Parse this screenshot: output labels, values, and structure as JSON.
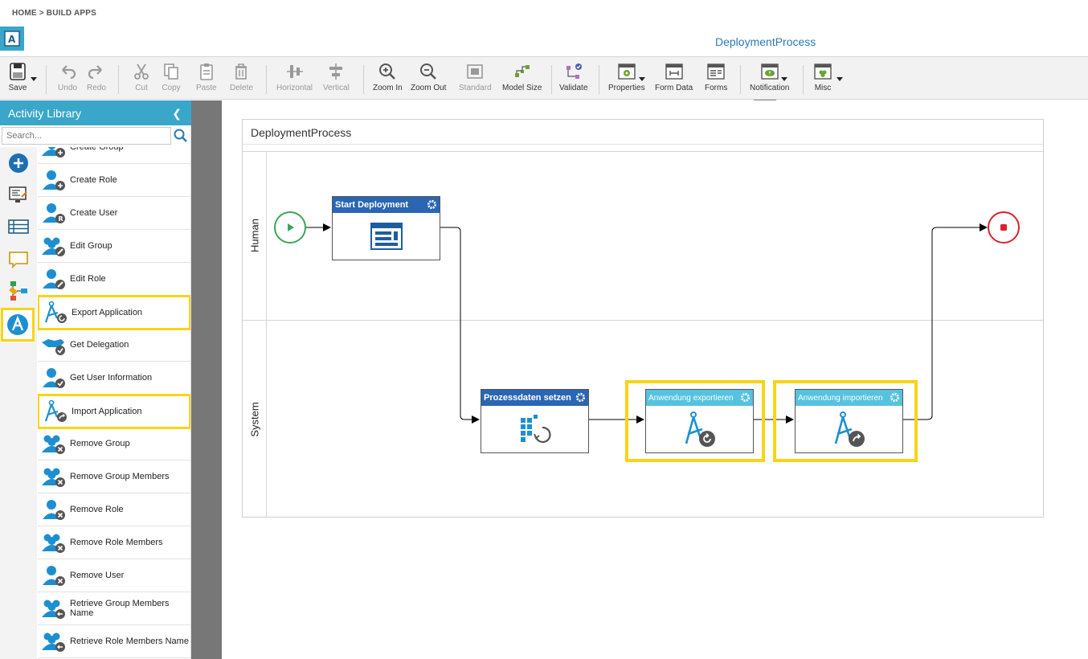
{
  "breadcrumb": "HOME > BUILD APPS",
  "app_title": "DeploymentProcess",
  "toolbar": {
    "save": "Save",
    "undo": "Undo",
    "redo": "Redo",
    "cut": "Cut",
    "copy": "Copy",
    "paste": "Paste",
    "delete": "Delete",
    "horizontal": "Horizontal",
    "vertical": "Vertical",
    "zoom_in": "Zoom In",
    "zoom_out": "Zoom Out",
    "standard": "Standard",
    "model_size": "Model Size",
    "validate": "Validate",
    "properties": "Properties",
    "form_data": "Form Data",
    "forms": "Forms",
    "notification": "Notification",
    "misc": "Misc"
  },
  "sidebar": {
    "title": "Activity Library",
    "search_placeholder": "Search...",
    "categories": [
      "add-icon",
      "form-icon",
      "list-icon",
      "comment-icon",
      "workflow-icon",
      "apps-icon"
    ],
    "items": [
      {
        "label": "Create Group",
        "highlighted": false
      },
      {
        "label": "Create Role",
        "highlighted": false
      },
      {
        "label": "Create User",
        "highlighted": false
      },
      {
        "label": "Edit Group",
        "highlighted": false
      },
      {
        "label": "Edit Role",
        "highlighted": false
      },
      {
        "label": "Export Application",
        "highlighted": true
      },
      {
        "label": "Get Delegation",
        "highlighted": false
      },
      {
        "label": "Get User Information",
        "highlighted": false
      },
      {
        "label": "Import Application",
        "highlighted": true
      },
      {
        "label": "Remove Group",
        "highlighted": false
      },
      {
        "label": "Remove Group Members",
        "highlighted": false
      },
      {
        "label": "Remove Role",
        "highlighted": false
      },
      {
        "label": "Remove Role Members",
        "highlighted": false
      },
      {
        "label": "Remove User",
        "highlighted": false
      },
      {
        "label": "Retrieve Group Members Name",
        "highlighted": false
      },
      {
        "label": "Retrieve Role Members Name",
        "highlighted": false
      }
    ]
  },
  "diagram": {
    "pool_title": "DeploymentProcess",
    "lanes": [
      {
        "label": "Human"
      },
      {
        "label": "System"
      }
    ],
    "tasks": {
      "start_deployment": "Start Deployment",
      "prozessdaten": "Prozessdaten setzen",
      "export": "Anwendung exportieren",
      "import": "Anwendung importieren"
    }
  },
  "colors": {
    "accent": "#3aa6c9",
    "task_dark": "#2a66b3",
    "task_light": "#55c2e0",
    "highlight": "#f7d417",
    "start_event": "#3aa655",
    "end_event": "#d9232e"
  }
}
